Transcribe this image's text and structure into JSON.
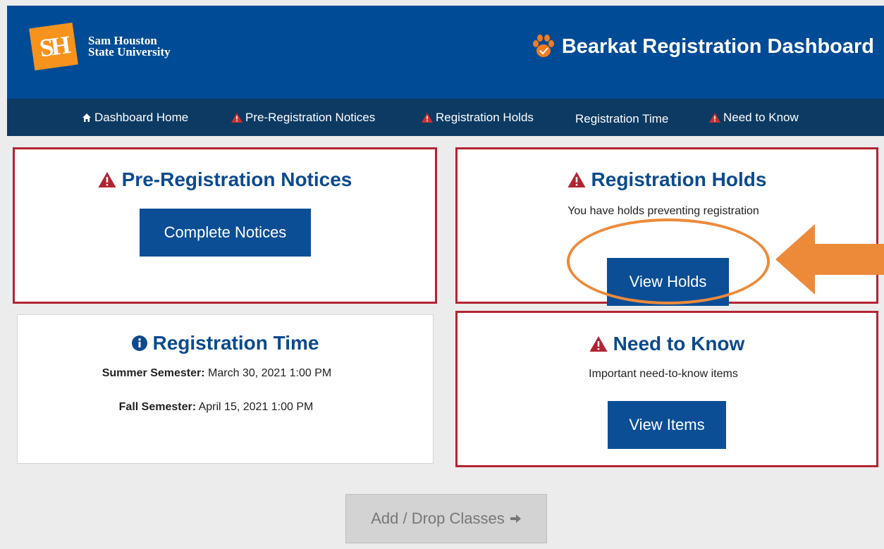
{
  "header": {
    "logo_monogram": "SH",
    "logo_line1": "Sam Houston",
    "logo_line2": "State University",
    "app_title": "Bearkat Registration Dashboard"
  },
  "nav": {
    "items": [
      {
        "label": "Dashboard Home",
        "icon": "home-icon"
      },
      {
        "label": "Pre-Registration Notices",
        "icon": "warning-icon"
      },
      {
        "label": "Registration Holds",
        "icon": "warning-icon"
      },
      {
        "label": "Registration Time",
        "icon": ""
      },
      {
        "label": "Need to Know",
        "icon": "warning-icon"
      }
    ]
  },
  "cards": {
    "pre_registration": {
      "title": "Pre-Registration Notices",
      "button": "Complete Notices"
    },
    "holds": {
      "title": "Registration Holds",
      "text": "You have holds preventing registration",
      "button": "View Holds"
    },
    "time": {
      "title": "Registration Time",
      "summer_label": "Summer Semester:",
      "summer_value": "March 30, 2021 1:00 PM",
      "fall_label": "Fall Semester:",
      "fall_value": "April 15, 2021 1:00 PM"
    },
    "need_to_know": {
      "title": "Need to Know",
      "text": "Important need-to-know items",
      "button": "View Items"
    }
  },
  "footer": {
    "add_drop_label": "Add / Drop Classes"
  },
  "colors": {
    "header_bg": "#004b96",
    "nav_bg": "#0c3a63",
    "alert_border": "#b32432",
    "button_bg": "#0b4e96",
    "title_color": "#0b4a8e",
    "annotation": "#ed8a3a",
    "logo_orange": "#f7931d"
  }
}
